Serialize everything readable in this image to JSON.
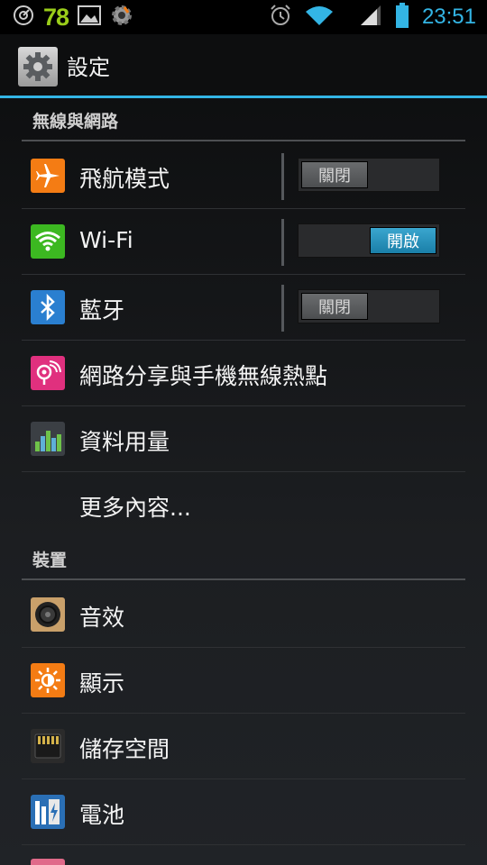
{
  "status_bar": {
    "battery_level_number": "78",
    "time": "23:51",
    "icons": [
      "usb-debug-icon",
      "picture-icon",
      "settings-notification-icon",
      "alarm-icon",
      "wifi-signal-icon",
      "cell-signal-icon",
      "battery-icon"
    ]
  },
  "action_bar": {
    "title": "設定",
    "icon": "gear-icon"
  },
  "sections": [
    {
      "header": "無線與網路",
      "items": [
        {
          "label": "飛航模式",
          "icon": "airplane-icon",
          "toggle": "關閉",
          "toggle_state": "off",
          "icon_color": "#f47c14"
        },
        {
          "label": "Wi-Fi",
          "icon": "wifi-icon",
          "toggle": "開啟",
          "toggle_state": "on",
          "icon_color": "#3cb821"
        },
        {
          "label": "藍牙",
          "icon": "bluetooth-icon",
          "toggle": "關閉",
          "toggle_state": "off",
          "icon_color": "#2a7fd0"
        },
        {
          "label": "網路分享與手機無線熱點",
          "icon": "hotspot-icon",
          "icon_color": "#e0307e"
        },
        {
          "label": "資料用量",
          "icon": "data-usage-icon",
          "icon_color": "#3b3f44"
        },
        {
          "label": "更多內容..."
        }
      ]
    },
    {
      "header": "裝置",
      "items": [
        {
          "label": "音效",
          "icon": "speaker-icon",
          "icon_color": "#c9a06a"
        },
        {
          "label": "顯示",
          "icon": "brightness-icon",
          "icon_color": "#f47c14"
        },
        {
          "label": "儲存空間",
          "icon": "sd-card-icon",
          "icon_color": "#2b2b2b"
        },
        {
          "label": "電池",
          "icon": "battery-settings-icon",
          "icon_color": "#2a6fb5"
        }
      ]
    }
  ]
}
